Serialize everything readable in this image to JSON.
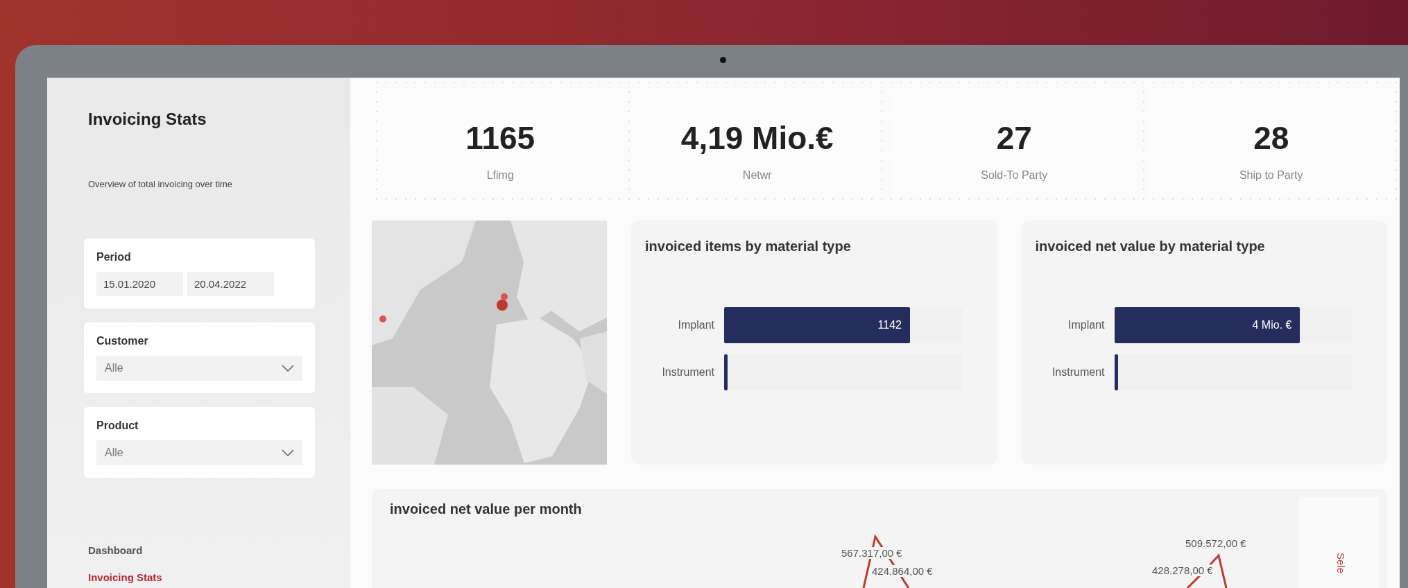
{
  "sidebar": {
    "title": "Invoicing Stats",
    "subtitle": "Overview of total invoicing over time",
    "filters": [
      {
        "kind": "dates",
        "label": "Period",
        "values": [
          "15.01.2020",
          "20.04.2022"
        ]
      },
      {
        "kind": "dropdown",
        "label": "Customer",
        "value": "Alle"
      },
      {
        "kind": "dropdown",
        "label": "Product",
        "value": "Alle"
      }
    ],
    "nav": [
      {
        "label": "Dashboard",
        "selected": false
      },
      {
        "label": "Invoicing Stats",
        "selected": true
      }
    ]
  },
  "kpis": [
    {
      "value": "1165",
      "label": "Lfimg"
    },
    {
      "value": "4,19 Mio.€",
      "label": "Netwr"
    },
    {
      "value": "27",
      "label": "Sold-To Party"
    },
    {
      "value": "28",
      "label": "Ship to Party"
    }
  ],
  "bar_cards": [
    {
      "title": "invoiced items by material type",
      "rows": [
        {
          "category": "Implant",
          "value_label": "1142",
          "level": 0.78
        },
        {
          "category": "Instrument",
          "level": 0.015
        }
      ]
    },
    {
      "title": "invoiced net value by material type",
      "rows": [
        {
          "category": "Implant",
          "value_label": "4 Mio. €",
          "level": 0.78
        },
        {
          "category": "Instrument",
          "level": 0.015
        }
      ]
    }
  ],
  "line_card": {
    "title": "invoiced net value per month",
    "labels": [
      "567.317,00 €",
      "424.864,00 €",
      "509.572,00 €",
      "428.278,00 €"
    ],
    "side_label": "Sele"
  }
}
